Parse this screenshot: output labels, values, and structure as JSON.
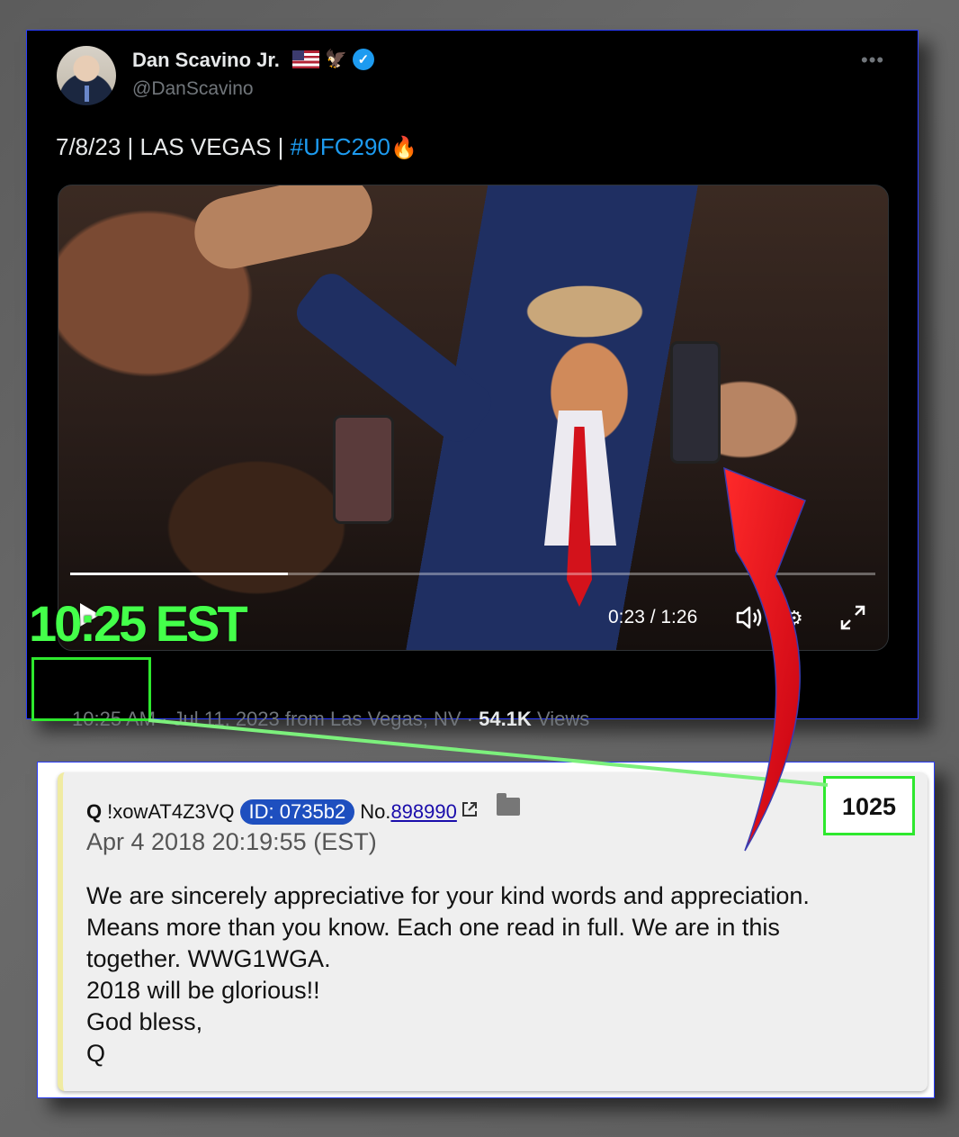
{
  "tweet": {
    "display_name": "Dan Scavino Jr.",
    "handle": "@DanScavino",
    "more": "•••",
    "verified_mark": "✓",
    "eagle": "🦅",
    "text_plain": "7/8/23 | LAS VEGAS | ",
    "hashtag": "#UFC290",
    "emoji": "🔥",
    "video": {
      "progress_fraction": 0.27,
      "time_readout": "0:23 / 1:26"
    },
    "meta_time": "10:25 AM",
    "meta_rest": "· Jul 11, 2023 from Las Vegas, NV ·",
    "views_count": "54.1K",
    "views_label": "Views",
    "colors": {
      "accent": "#1d9bf0",
      "background": "#000000"
    }
  },
  "overlay": {
    "time_label": "10:25 EST",
    "highlight_color": "#2ee82e",
    "arrow_color": "#e0101c"
  },
  "qpost": {
    "name": "Q",
    "tripcode": "!xowAT4Z3VQ",
    "id_badge": "ID: 0735b2",
    "no_label": "No.",
    "post_number": "898990",
    "date": "Apr 4 2018 20:19:55 (EST)",
    "post_count": "1025",
    "body_lines": [
      "We are sincerely appreciative for your kind words and appreciation.",
      "Means more than you know. Each one read in full. We are in this",
      "together. WWG1WGA.",
      "2018 will be glorious!!",
      "God bless,",
      "Q"
    ]
  }
}
